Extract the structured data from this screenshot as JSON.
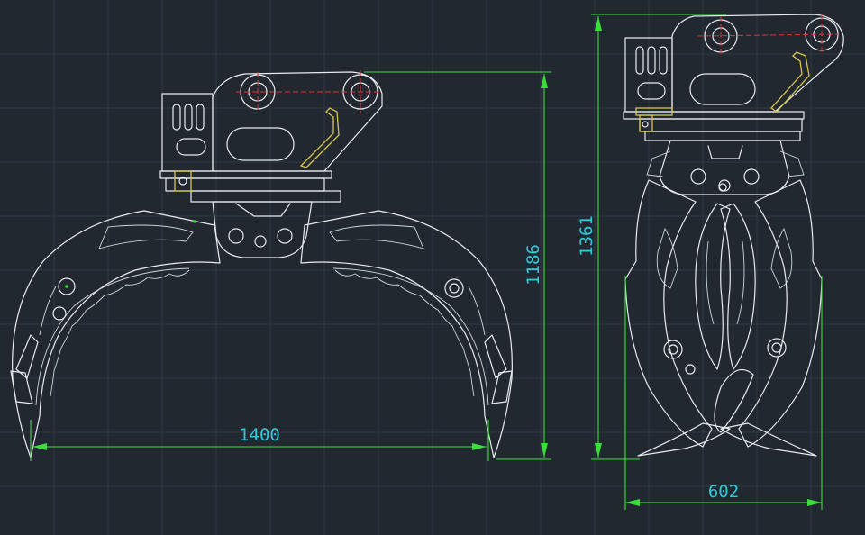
{
  "dimensions": {
    "width_text": "1400",
    "height_text": "1186",
    "total_height_text": "1361",
    "side_width_text": "602"
  },
  "colors": {
    "background": "#212830",
    "line": "#e8ecef",
    "dimension_line": "#3ddc3d",
    "dimension_text": "#32c8d8",
    "centerline": "#e23030",
    "hose": "#d8c44a"
  }
}
